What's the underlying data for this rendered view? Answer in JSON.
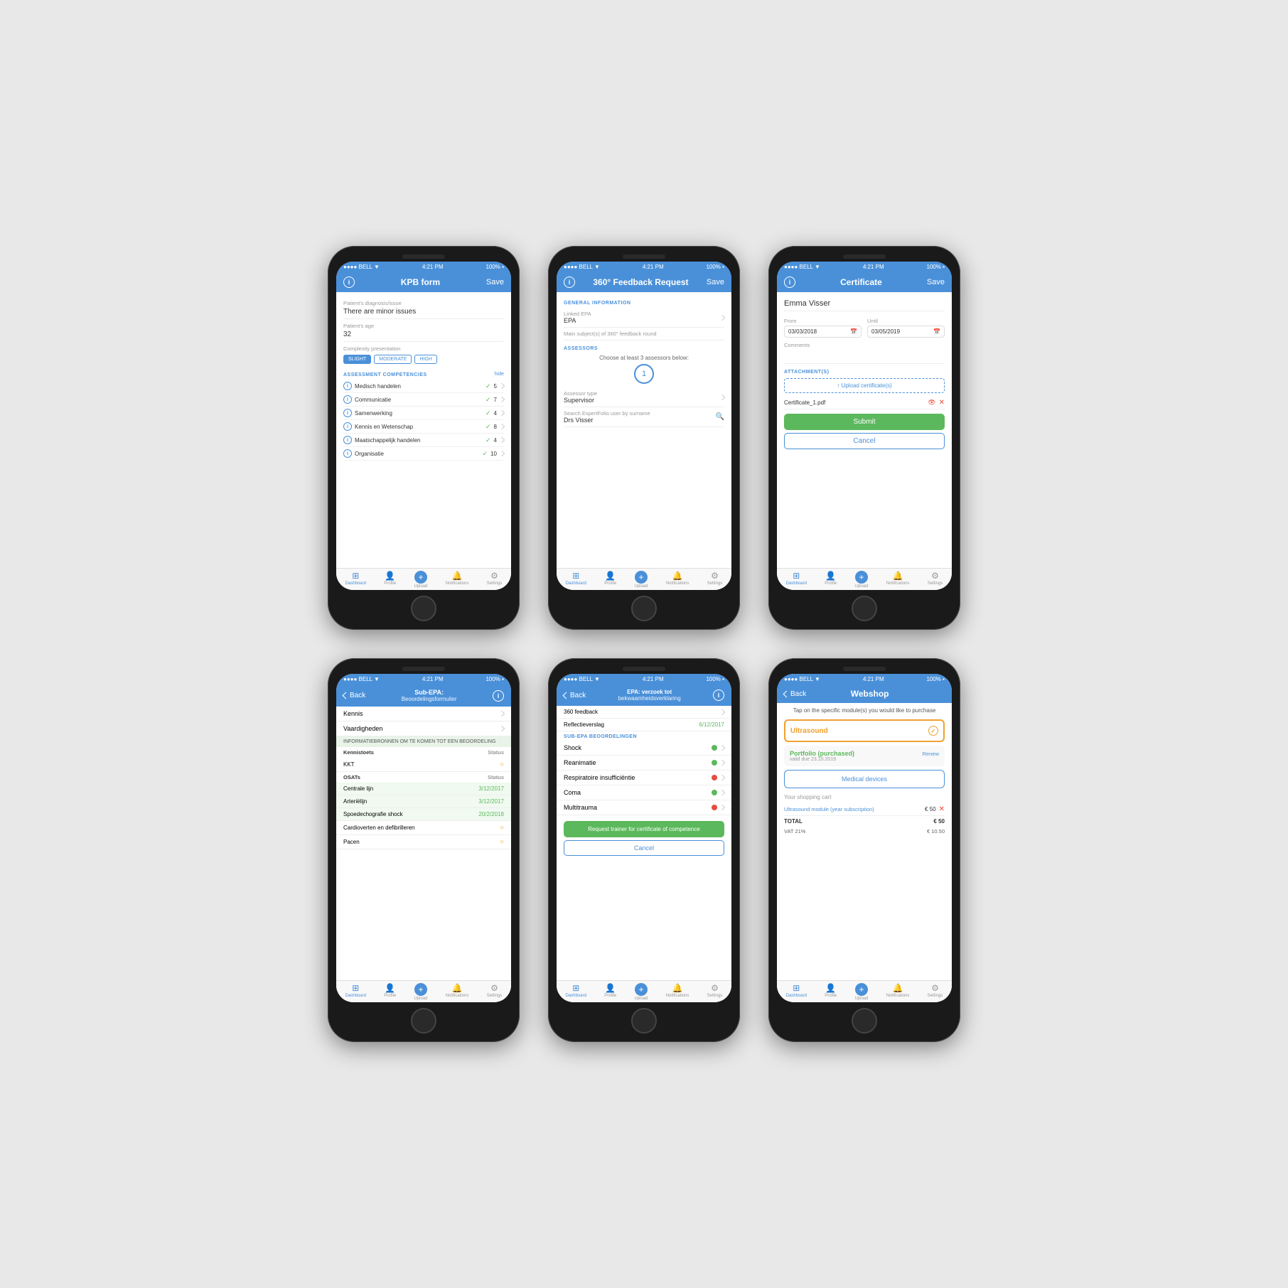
{
  "phones": [
    {
      "id": "phone1",
      "header": {
        "left": "info",
        "title": "KPB form",
        "right": "Save"
      },
      "screen": "kpb"
    },
    {
      "id": "phone2",
      "header": {
        "left": "info",
        "title": "360° Feedback Request",
        "right": "Save"
      },
      "screen": "feedback360"
    },
    {
      "id": "phone3",
      "header": {
        "left": "info",
        "title": "Certificate",
        "right": "Save"
      },
      "screen": "certificate"
    },
    {
      "id": "phone4",
      "header": {
        "left_back": "Back",
        "title": "Sub-EPA: Beoordelingsformulier",
        "right": "info"
      },
      "screen": "subepa"
    },
    {
      "id": "phone5",
      "header": {
        "left_back": "Back",
        "title": "EPA: verzoek tot bekwaamheidsverklaring",
        "right": "info"
      },
      "screen": "epaverzoek"
    },
    {
      "id": "phone6",
      "header": {
        "left_back": "Back",
        "title": "Webshop",
        "right": ""
      },
      "screen": "webshop"
    }
  ],
  "kpb": {
    "patient_diagnosis_label": "Patient's diagnosis/issue",
    "patient_diagnosis_value": "There are minor issues",
    "patient_age_label": "Patient's age",
    "patient_age_value": "32",
    "complexity_label": "Complexity presentation",
    "complexity_options": [
      "SLIGHT",
      "MODERATE",
      "HIGH"
    ],
    "complexity_active": "SLIGHT",
    "assessment_label": "ASSESSMENT COMPETENCIES",
    "hide_label": "hide",
    "competencies": [
      {
        "name": "Medisch handelen",
        "score": 5
      },
      {
        "name": "Communicatie",
        "score": 7
      },
      {
        "name": "Samenwerking",
        "score": 4
      },
      {
        "name": "Kennis en Wetenschap",
        "score": 8
      },
      {
        "name": "Maatschappelijk handelen",
        "score": 4
      },
      {
        "name": "Organisatie",
        "score": 10
      }
    ]
  },
  "feedback360": {
    "general_info_label": "GENERAL INFORMATION",
    "linked_epa_label": "Linked EPA",
    "linked_epa_value": "EPA",
    "main_subjects_label": "Main subject(s) of 360° feedback round",
    "assessors_label": "ASSESSORS",
    "choose_text": "Choose at least 3 assessors below:",
    "count": "1",
    "assessor_type_label": "Assessor type",
    "assessor_type_value": "Supervisor",
    "search_label": "Search ExpertFolio user by surname",
    "search_value": "Drs Visser"
  },
  "certificate": {
    "name": "Emma Visser",
    "from_label": "From",
    "from_value": "03/03/2018",
    "until_label": "Until",
    "until_value": "03/05/2019",
    "comments_label": "Comments",
    "attachments_label": "ATTACHMENT(S)",
    "upload_label": "Upload certificate(s)",
    "file_name": "Certificate_1.pdf",
    "submit_label": "Submit",
    "cancel_label": "Cancel"
  },
  "subepa": {
    "items": [
      {
        "label": "Kennis"
      },
      {
        "label": "Vaardigheden"
      }
    ],
    "info_text": "INFORMATIEBRONNEN OM TE KOMEN TOT EEN BEOORDELING",
    "kennistoets_label": "Kennistoets",
    "status_label": "Status",
    "kkt_label": "KKT",
    "osats_label": "OSATs",
    "osat_items": [
      {
        "name": "Centrale lijn",
        "date": "3/12/2017"
      },
      {
        "name": "Arteriëlijn",
        "date": "3/12/2017"
      },
      {
        "name": "Spoedechografie shock",
        "date": "20/2/2018"
      },
      {
        "name": "Cardioverten en defibrilleren",
        "pending": true
      },
      {
        "name": "Pacen",
        "pending": true
      }
    ]
  },
  "epaverzoek": {
    "item1_label": "360 feedback",
    "reflectieverslag_label": "Reflectieverslag",
    "reflectieverslag_date": "6/12/2017",
    "subepa_label": "SUB-EPA BEOORDELINGEN",
    "subepa_items": [
      {
        "name": "Shock",
        "active": true
      },
      {
        "name": "Reanimatie",
        "active": true
      },
      {
        "name": "Respiratoire insufficiëntie",
        "active": false
      },
      {
        "name": "Coma",
        "active": true
      },
      {
        "name": "Multitrauma",
        "active": false
      }
    ],
    "request_btn": "Request trainer for certificate of competence",
    "cancel_btn": "Cancel"
  },
  "webshop": {
    "intro": "Tap on the specific module(s) you would like to purchase",
    "ultrasound_label": "Ultrasound",
    "portfolio_label": "Portfolio (purchased)",
    "portfolio_valid": "valid due 23.10.2019",
    "renew_label": "Renew",
    "medical_devices_label": "Medical devices",
    "cart_title": "Your shopping cart",
    "cart_item_label": "Ultrasound module (year subscription)",
    "cart_item_price": "€ 50",
    "total_label": "TOTAL",
    "total_value": "€ 50",
    "vat_label": "VAT 21%",
    "vat_value": "€ 10.50"
  },
  "nav": {
    "items": [
      "Dashboard",
      "Profile",
      "Upload",
      "Notifications",
      "Settings"
    ]
  }
}
